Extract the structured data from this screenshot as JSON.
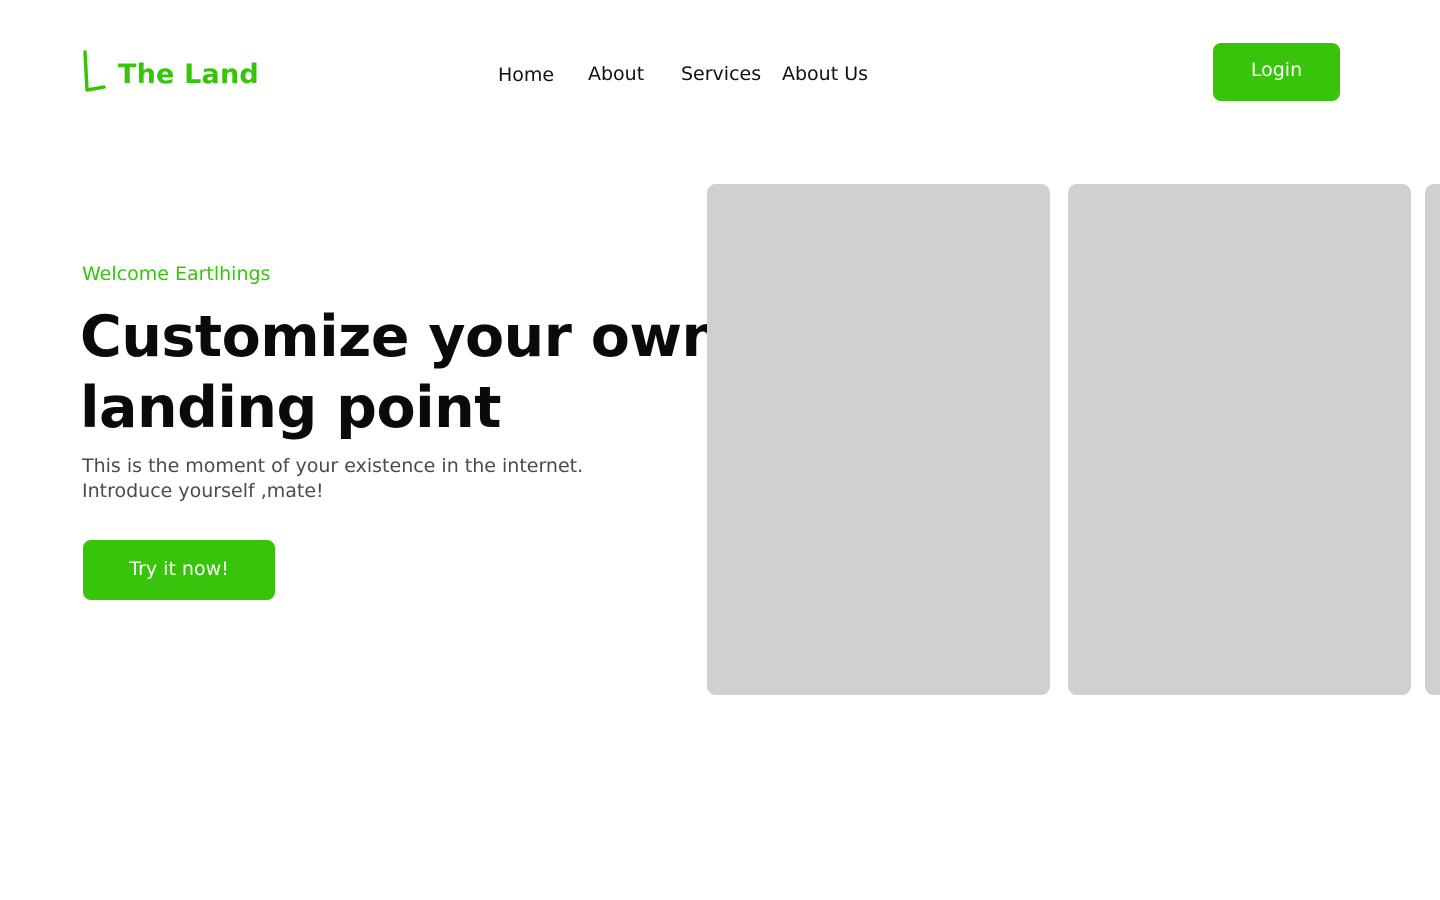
{
  "header": {
    "brand": "The Land",
    "nav": [
      "Home",
      "About",
      "Services",
      "About Us"
    ],
    "login_label": "Login"
  },
  "hero": {
    "eyebrow": "Welcome Eartlhings",
    "headline_line1": "Customize your own",
    "headline_line2": "landing point",
    "subtext_line1": "This is the moment of your existence in the internet.",
    "subtext_line2": "Introduce yourself ,mate!",
    "cta_label": "Try it now!"
  },
  "colors": {
    "accent": "#38c40a",
    "card_placeholder": "#d0d0d0",
    "heading": "#0a0a0a",
    "body_text": "#4a4a4a"
  },
  "icons": {
    "logo": "letter-l-logo-icon"
  }
}
